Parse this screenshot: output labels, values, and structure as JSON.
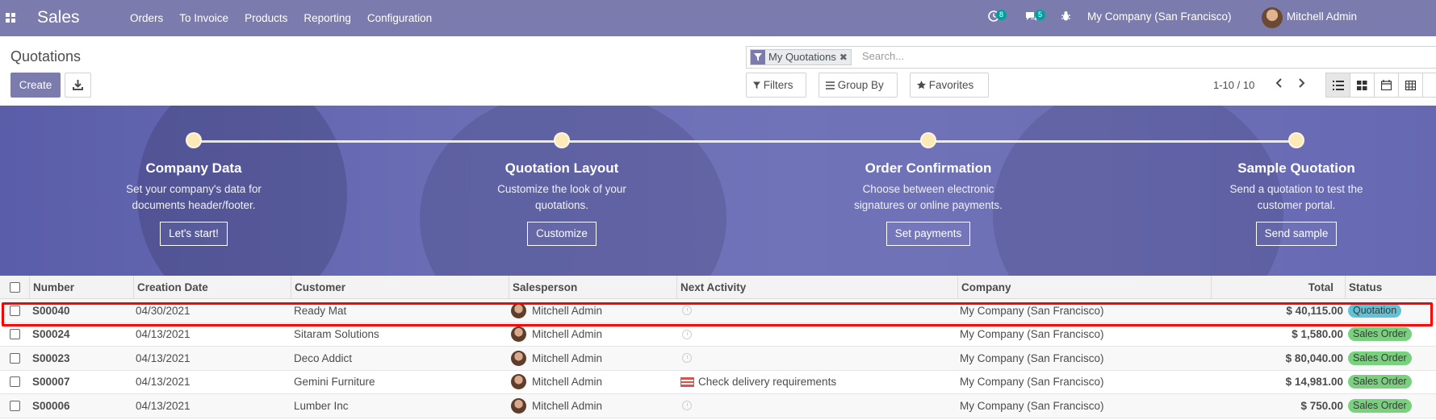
{
  "navbar": {
    "app_name": "Sales",
    "menu": [
      "Orders",
      "To Invoice",
      "Products",
      "Reporting",
      "Configuration"
    ],
    "activity_count": "8",
    "message_count": "5",
    "company": "My Company (San Francisco)",
    "user": "Mitchell Admin"
  },
  "control_panel": {
    "title": "Quotations",
    "create_label": "Create",
    "search": {
      "facet_label": "My Quotations",
      "placeholder": "Search..."
    },
    "filters_label": "Filters",
    "group_by_label": "Group By",
    "favorites_label": "Favorites",
    "pager": "1-10 / 10"
  },
  "onboarding": {
    "steps": [
      {
        "title": "Company Data",
        "desc1": "Set your company's data for",
        "desc2": "documents header/footer.",
        "button": "Let's start!"
      },
      {
        "title": "Quotation Layout",
        "desc1": "Customize the look of your",
        "desc2": "quotations.",
        "button": "Customize"
      },
      {
        "title": "Order Confirmation",
        "desc1": "Choose between electronic",
        "desc2": "signatures or online payments.",
        "button": "Set payments"
      },
      {
        "title": "Sample Quotation",
        "desc1": "Send a quotation to test the",
        "desc2": "customer portal.",
        "button": "Send sample"
      }
    ]
  },
  "list": {
    "headers": {
      "number": "Number",
      "creation_date": "Creation Date",
      "customer": "Customer",
      "salesperson": "Salesperson",
      "next_activity": "Next Activity",
      "company": "Company",
      "total": "Total",
      "status": "Status"
    },
    "rows": [
      {
        "number": "S00040",
        "date": "04/30/2021",
        "customer": "Ready Mat",
        "salesperson": "Mitchell Admin",
        "activity": "",
        "company": "My Company (San Francisco)",
        "total": "$ 40,115.00",
        "status": "Quotation"
      },
      {
        "number": "S00024",
        "date": "04/13/2021",
        "customer": "Sitaram Solutions",
        "salesperson": "Mitchell Admin",
        "activity": "",
        "company": "My Company (San Francisco)",
        "total": "$ 1,580.00",
        "status": "Sales Order"
      },
      {
        "number": "S00023",
        "date": "04/13/2021",
        "customer": "Deco Addict",
        "salesperson": "Mitchell Admin",
        "activity": "",
        "company": "My Company (San Francisco)",
        "total": "$ 80,040.00",
        "status": "Sales Order"
      },
      {
        "number": "S00007",
        "date": "04/13/2021",
        "customer": "Gemini Furniture",
        "salesperson": "Mitchell Admin",
        "activity": "Check delivery requirements",
        "company": "My Company (San Francisco)",
        "total": "$ 14,981.00",
        "status": "Sales Order"
      },
      {
        "number": "S00006",
        "date": "04/13/2021",
        "customer": "Lumber Inc",
        "salesperson": "Mitchell Admin",
        "activity": "",
        "company": "My Company (San Francisco)",
        "total": "$ 750.00",
        "status": "Sales Order"
      }
    ]
  },
  "colors": {
    "brand": "#7c7bad",
    "quotation_badge": "#62c1d4",
    "sales_order_badge": "#7ad07f",
    "highlight": "#ff0000"
  }
}
